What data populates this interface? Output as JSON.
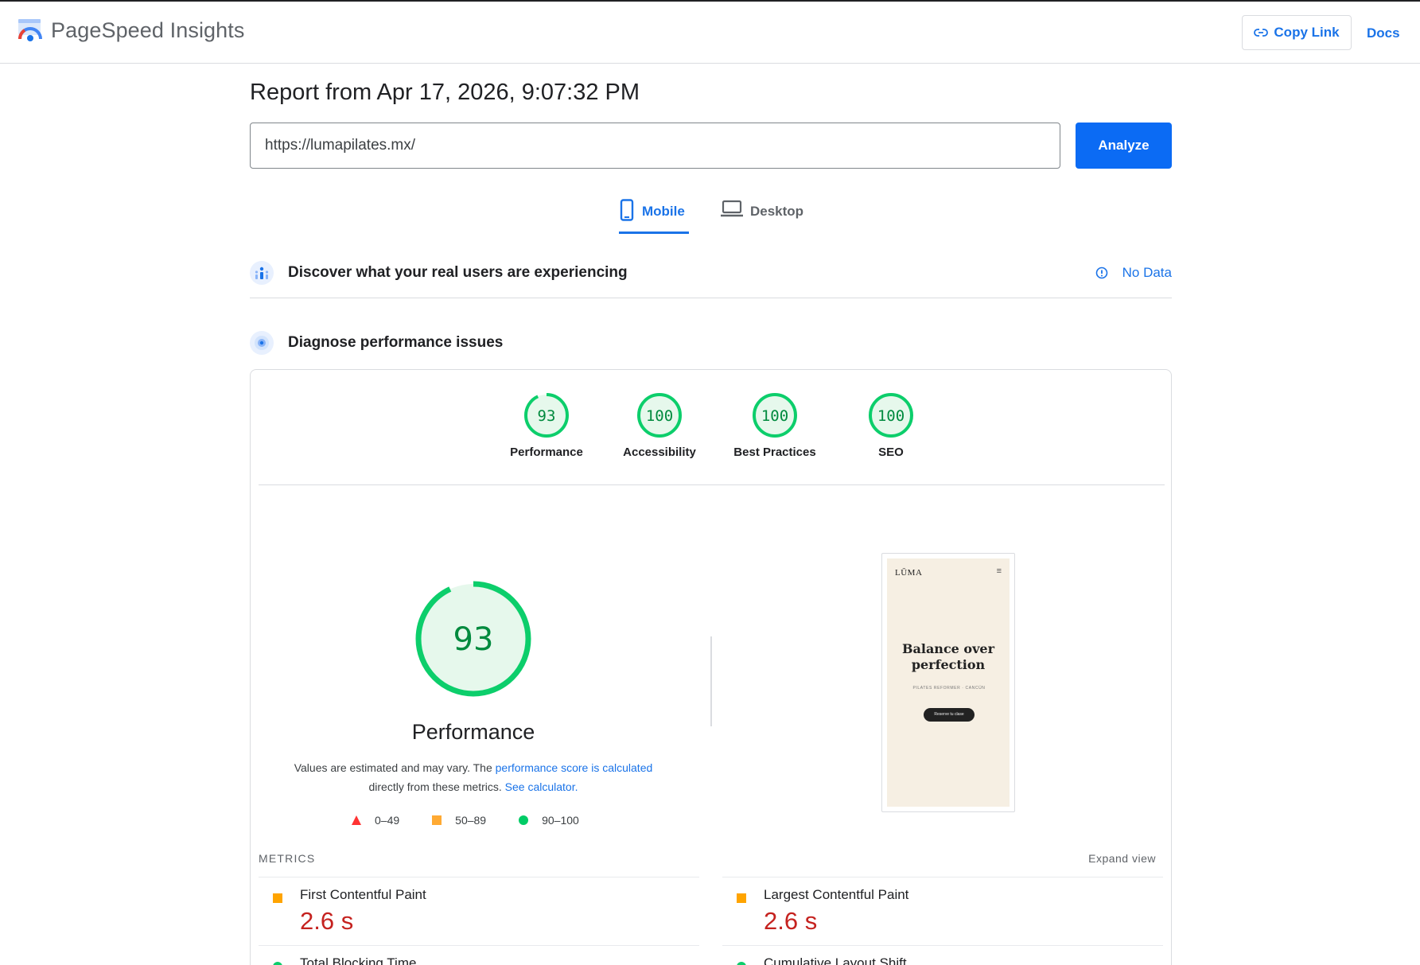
{
  "header": {
    "app_name": "PageSpeed Insights",
    "copy_link_label": "Copy Link",
    "docs_label": "Docs"
  },
  "report": {
    "title": "Report from Apr 17, 2026, 9:07:32 PM",
    "url_value": "https://lumapilates.mx/",
    "analyze_label": "Analyze"
  },
  "tabs": [
    {
      "label": "Mobile",
      "icon": "phone-icon",
      "selected": true
    },
    {
      "label": "Desktop",
      "icon": "laptop-icon",
      "selected": false
    }
  ],
  "field_section": {
    "title": "Discover what your real users are experiencing",
    "status": "No Data"
  },
  "lab_section": {
    "title": "Diagnose performance issues"
  },
  "scores": [
    {
      "label": "Performance",
      "value": "93",
      "fraction": 0.93
    },
    {
      "label": "Accessibility",
      "value": "100",
      "fraction": 1.0
    },
    {
      "label": "Best Practices",
      "value": "100",
      "fraction": 1.0
    },
    {
      "label": "SEO",
      "value": "100",
      "fraction": 1.0
    }
  ],
  "performance": {
    "score": "93",
    "fraction": 0.93,
    "title": "Performance",
    "explain_prefix": "Values are estimated and may vary. The ",
    "explain_link1": "performance score is calculated",
    "explain_middle": " directly from these metrics. ",
    "explain_link2": "See calculator."
  },
  "legend": [
    {
      "range": "0–49",
      "shape": "triangle",
      "color": "#f33"
    },
    {
      "range": "50–89",
      "shape": "square",
      "color": "#fa3"
    },
    {
      "range": "90–100",
      "shape": "circle",
      "color": "#0c6"
    }
  ],
  "screenshot": {
    "logo": "LŪMA",
    "headline": "Balance over perfection",
    "tagline": "PILATES REFORMER · CANCÚN",
    "button": "Reserve tu clase"
  },
  "metrics": {
    "heading": "METRICS",
    "expand_label": "Expand view",
    "items": [
      {
        "label": "First Contentful Paint",
        "value": "2.6 s",
        "rating": "average"
      },
      {
        "label": "Largest Contentful Paint",
        "value": "2.6 s",
        "rating": "average"
      },
      {
        "label": "Total Blocking Time",
        "value": "",
        "rating": "pass"
      },
      {
        "label": "Cumulative Layout Shift",
        "value": "",
        "rating": "pass"
      }
    ]
  },
  "colors": {
    "accent": "#1a73e8",
    "analyze_bg": "#0b6bf4",
    "pass": "#0cce6b",
    "average": "#ffa400",
    "fail": "#ff4e42",
    "metric_value": "#c5221f"
  }
}
